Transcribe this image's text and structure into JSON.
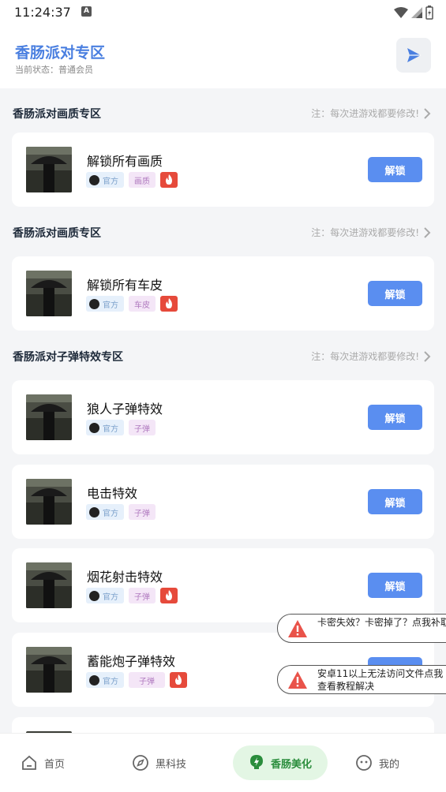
{
  "status_bar": {
    "time": "11:24:37",
    "app_icon_letter": "A"
  },
  "header": {
    "title": "香肠派对专区",
    "member_status": "当前状态：普通会员",
    "action_icon": "play-icon"
  },
  "sections": [
    {
      "title": "香肠派对画质专区",
      "note": "注：每次进游戏都要修改!"
    },
    {
      "title": "香肠派对画质专区",
      "note": "注：每次进游戏都要修改!"
    },
    {
      "title": "香肠派对子弹特效专区",
      "note": "注：每次进游戏都要修改!"
    }
  ],
  "items": [
    {
      "title": "解锁所有画质",
      "official": "官方",
      "category": "画质",
      "hot": true,
      "button": "解锁"
    },
    {
      "title": "解锁所有车皮",
      "official": "官方",
      "category": "车皮",
      "hot": true,
      "button": "解锁"
    },
    {
      "title": "狼人子弹特效",
      "official": "官方",
      "category": "子弹",
      "hot": false,
      "button": "解锁"
    },
    {
      "title": "电击特效",
      "official": "官方",
      "category": "子弹",
      "hot": false,
      "button": "解锁"
    },
    {
      "title": "烟花射击特效",
      "official": "官方",
      "category": "子弹",
      "hot": true,
      "button": "解锁"
    },
    {
      "title": "蓄能炮子弹特效",
      "official": "官方",
      "category": "子弹",
      "hot": true,
      "button": "解锁"
    }
  ],
  "toasts": [
    {
      "text": "卡密失效？卡密掉了？点我补取",
      "icon": "warning-icon"
    },
    {
      "text": "安卓11以上无法访问文件点我查看教程解决",
      "icon": "warning-icon"
    }
  ],
  "bottom_nav": [
    {
      "label": "首页",
      "icon": "home-icon"
    },
    {
      "label": "黑科技",
      "icon": "compass-icon"
    },
    {
      "label": "香肠美化",
      "icon": "bolt-icon",
      "active": true
    },
    {
      "label": "我的",
      "icon": "face-icon"
    }
  ],
  "colors": {
    "accent": "#4a7fe0",
    "button": "#5a8ef0",
    "hot": "#e64a3b",
    "nav_active_bg": "#e3f6e4",
    "nav_active_text": "#2a8d3c",
    "warning": "#e9534a"
  }
}
